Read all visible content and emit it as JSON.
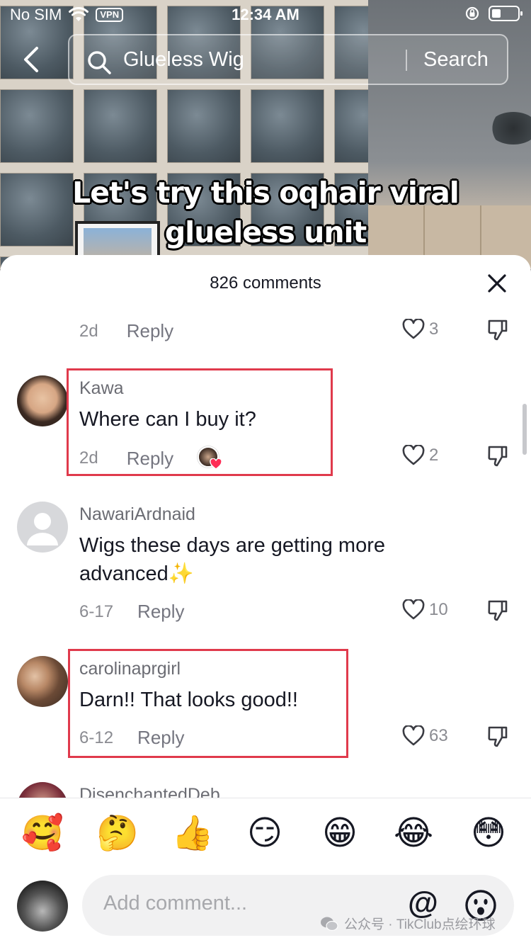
{
  "status_bar": {
    "carrier": "No SIM",
    "vpn": "VPN",
    "time": "12:34 AM",
    "battery_level": 0.35
  },
  "search": {
    "query": "Glueless Wig",
    "button_label": "Search"
  },
  "video": {
    "caption_line1": "Let's  try this oqhair  viral",
    "caption_line2": "glueless unit"
  },
  "comments_sheet": {
    "title": "826 comments",
    "partial_top": {
      "date": "2d",
      "reply_label": "Reply",
      "likes": "3"
    },
    "comments": [
      {
        "username": "Kawa",
        "text": "Where can I buy it?",
        "date": "2d",
        "reply_label": "Reply",
        "likes": "2",
        "creator_liked": true
      },
      {
        "username": "NawariArdnaid",
        "text_line1": "Wigs these days are getting more",
        "text_line2": "advanced✨",
        "date": "6-17",
        "reply_label": "Reply",
        "likes": "10"
      },
      {
        "username": "carolinaprgirl",
        "text": "Darn!! That looks good!!",
        "date": "6-12",
        "reply_label": "Reply",
        "likes": "63"
      },
      {
        "username": "DisenchantedDeb"
      }
    ]
  },
  "quick_emojis": [
    "🥰",
    "🤔",
    "👍",
    "😏",
    "😁",
    "😂",
    "😳"
  ],
  "input": {
    "placeholder": "Add comment...",
    "mention_symbol": "@"
  },
  "watermark": "公众号 · TikClub点绘环球",
  "colors": {
    "highlight": "#e03a4c",
    "text_primary": "#161823",
    "text_secondary": "#8a8b91",
    "heart_red": "#fe2c55"
  }
}
